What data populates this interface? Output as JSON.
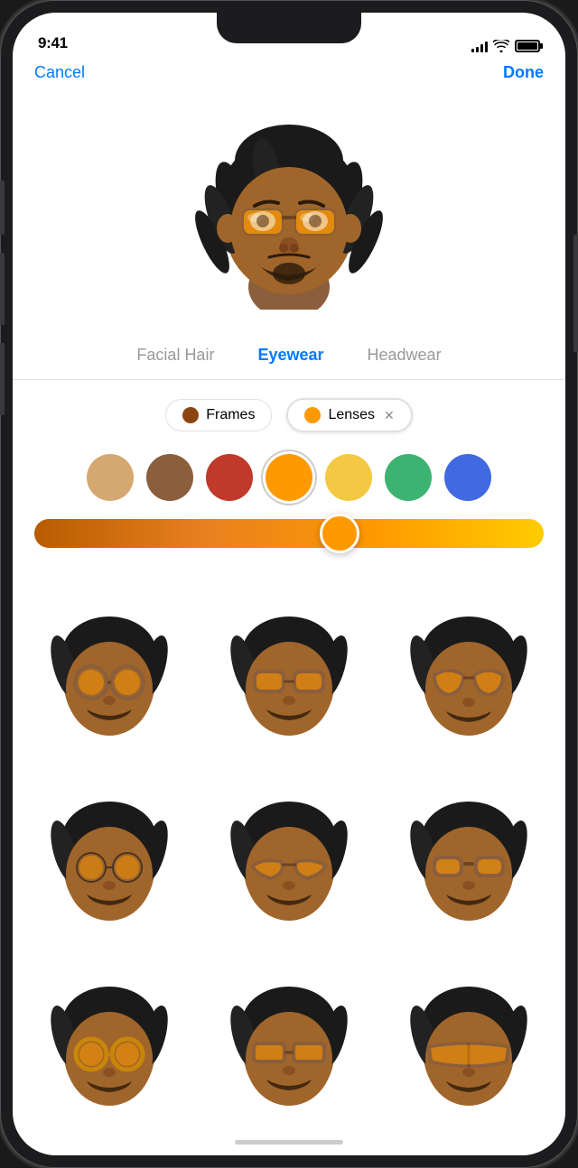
{
  "statusBar": {
    "time": "9:41",
    "batteryDot": "●"
  },
  "nav": {
    "cancel": "Cancel",
    "done": "Done"
  },
  "tabs": [
    {
      "label": "Facial Hair",
      "active": false
    },
    {
      "label": "Eyewear",
      "active": true
    },
    {
      "label": "Headwear",
      "active": false
    }
  ],
  "filters": {
    "frames_label": "Frames",
    "lenses_label": "Lenses",
    "frames_color": "#8B4513",
    "lenses_color": "#FF9900"
  },
  "swatches": [
    {
      "color": "#D4A870",
      "selected": false
    },
    {
      "color": "#8B5E3C",
      "selected": false
    },
    {
      "color": "#C0392B",
      "selected": false
    },
    {
      "color": "#FF9900",
      "selected": true
    },
    {
      "color": "#F4C842",
      "selected": false
    },
    {
      "color": "#3CB371",
      "selected": false
    },
    {
      "color": "#4169E1",
      "selected": false
    }
  ],
  "memoji": {
    "grid_count": 9
  }
}
